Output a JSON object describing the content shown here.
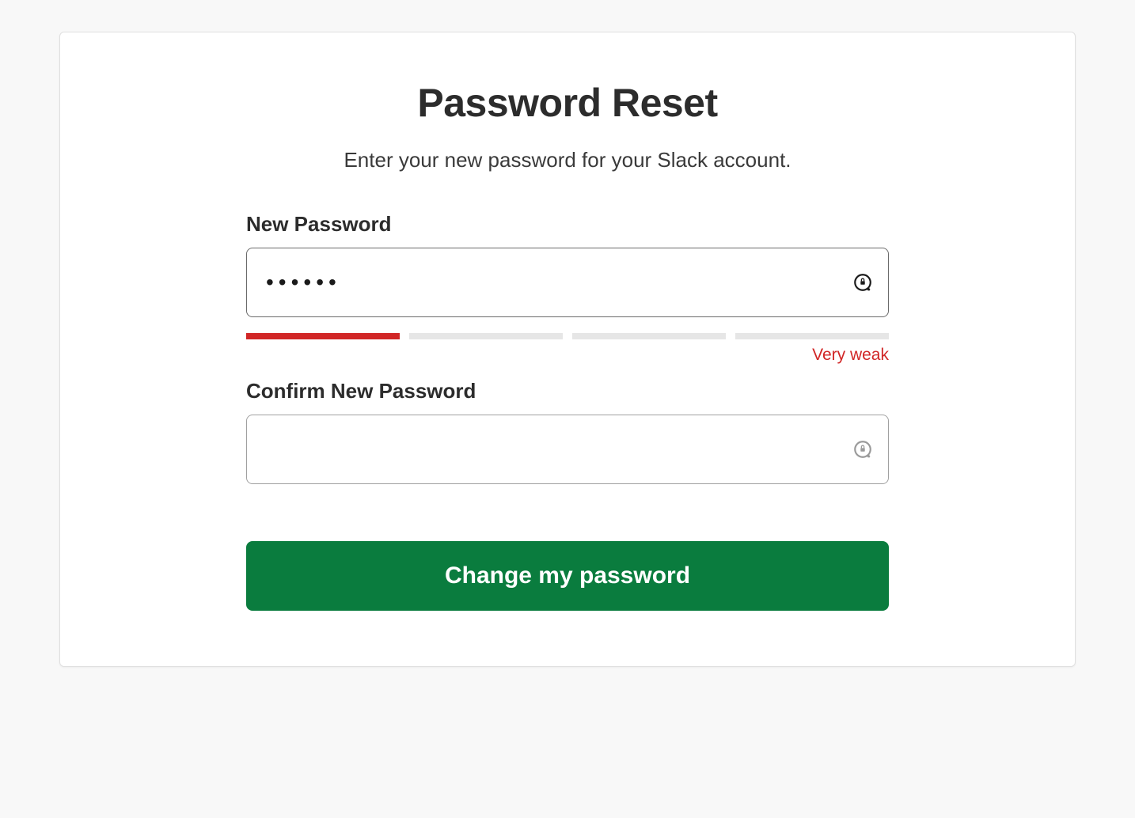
{
  "header": {
    "title": "Password Reset",
    "subtitle": "Enter your new password for your  Slack account."
  },
  "form": {
    "new_password": {
      "label": "New Password",
      "value": "aaaaaa",
      "strength": {
        "level": 1,
        "total_segments": 4,
        "label": "Very weak",
        "color": "#d12626"
      }
    },
    "confirm_password": {
      "label": "Confirm New Password",
      "value": ""
    },
    "submit_label": "Change my password"
  },
  "icons": {
    "lock_refresh": "password-manager-icon"
  }
}
